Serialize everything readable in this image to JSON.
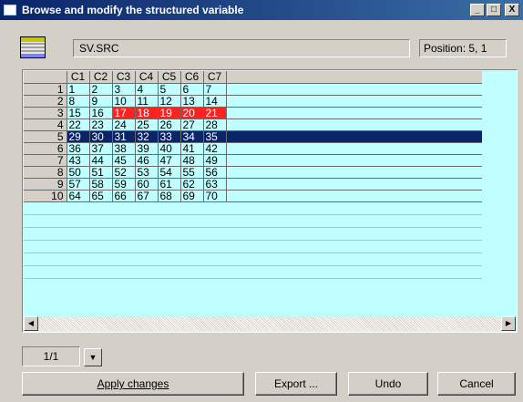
{
  "window": {
    "title": "Browse and modify the structured variable",
    "buttons": [
      "_",
      "□",
      "X"
    ]
  },
  "variable": {
    "name": "SV.SRC",
    "position": "Position: 5, 1"
  },
  "grid": {
    "columns": [
      "C1",
      "C2",
      "C3",
      "C4",
      "C5",
      "C6",
      "C7"
    ],
    "rows": [
      {
        "label": "1",
        "cells": [
          "1",
          "2",
          "3",
          "4",
          "5",
          "6",
          "7"
        ]
      },
      {
        "label": "2",
        "cells": [
          "8",
          "9",
          "10",
          "11",
          "12",
          "13",
          "14"
        ]
      },
      {
        "label": "3",
        "cells": [
          "15",
          "16",
          "17",
          "18",
          "19",
          "20",
          "21"
        ]
      },
      {
        "label": "4",
        "cells": [
          "22",
          "23",
          "24",
          "25",
          "26",
          "27",
          "28"
        ]
      },
      {
        "label": "5",
        "cells": [
          "29",
          "30",
          "31",
          "32",
          "33",
          "34",
          "35"
        ]
      },
      {
        "label": "6",
        "cells": [
          "36",
          "37",
          "38",
          "39",
          "40",
          "41",
          "42"
        ]
      },
      {
        "label": "7",
        "cells": [
          "43",
          "44",
          "45",
          "46",
          "47",
          "48",
          "49"
        ]
      },
      {
        "label": "8",
        "cells": [
          "50",
          "51",
          "52",
          "53",
          "54",
          "55",
          "56"
        ]
      },
      {
        "label": "9",
        "cells": [
          "57",
          "58",
          "59",
          "60",
          "61",
          "62",
          "63"
        ]
      },
      {
        "label": "10",
        "cells": [
          "64",
          "65",
          "66",
          "67",
          "68",
          "69",
          "70"
        ]
      }
    ],
    "selected_row": "5",
    "highlighted_cells": {
      "row": "3",
      "columns": [
        "C3",
        "C4",
        "C5",
        "C6",
        "C7"
      ]
    },
    "colors": {
      "cell_bg": "#c0ffff",
      "selected_bg": "#0a246a",
      "highlight_bg": "#ff2020"
    }
  },
  "pager": {
    "value": "1/1"
  },
  "buttons": {
    "apply": "Apply changes",
    "export": "Export ...",
    "undo": "Undo",
    "cancel": "Cancel"
  }
}
